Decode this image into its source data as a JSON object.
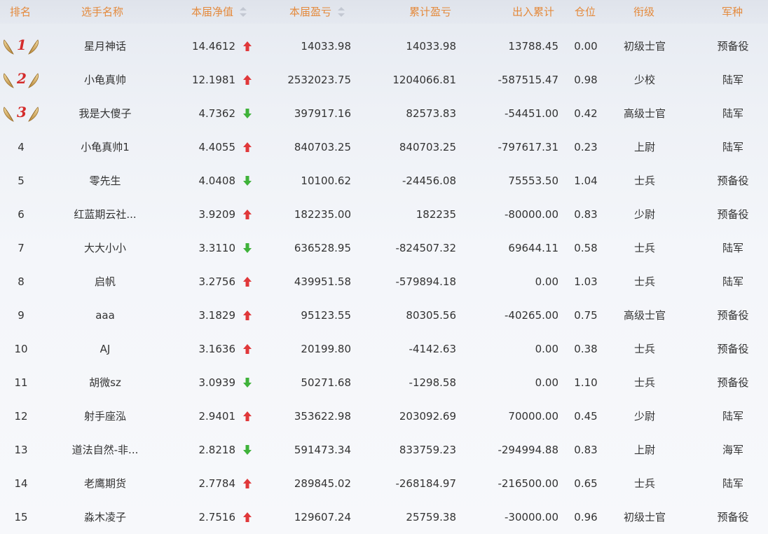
{
  "columns": {
    "rank": "排名",
    "player": "选手名称",
    "nav": "本届净值",
    "pnl": "本届盈亏",
    "cum_pnl": "累计盈亏",
    "flow": "出入累计",
    "position": "仓位",
    "title": "衔级",
    "service": "军种"
  },
  "colors": {
    "header_text": "#e48a3c",
    "up": "#e0383a",
    "down": "#3fb23a",
    "rank_badge": "#d42b2b"
  },
  "rows": [
    {
      "rank": "1",
      "top": true,
      "name": "星月神话",
      "nav": "14.4612",
      "trend": "up",
      "pnl": "14033.98",
      "cum": "14033.98",
      "flow": "13788.45",
      "pos": "0.00",
      "title": "初级士官",
      "service": "预备役"
    },
    {
      "rank": "2",
      "top": true,
      "name": "小龟真帅",
      "nav": "12.1981",
      "trend": "up",
      "pnl": "2532023.75",
      "cum": "1204066.81",
      "flow": "-587515.47",
      "pos": "0.98",
      "title": "少校",
      "service": "陆军"
    },
    {
      "rank": "3",
      "top": true,
      "name": "我是大傻子",
      "nav": "4.7362",
      "trend": "down",
      "pnl": "397917.16",
      "cum": "82573.83",
      "flow": "-54451.00",
      "pos": "0.42",
      "title": "高级士官",
      "service": "陆军"
    },
    {
      "rank": "4",
      "top": false,
      "name": "小龟真帅1",
      "nav": "4.4055",
      "trend": "up",
      "pnl": "840703.25",
      "cum": "840703.25",
      "flow": "-797617.31",
      "pos": "0.23",
      "title": "上尉",
      "service": "陆军"
    },
    {
      "rank": "5",
      "top": false,
      "name": "零先生",
      "nav": "4.0408",
      "trend": "down",
      "pnl": "10100.62",
      "cum": "-24456.08",
      "flow": "75553.50",
      "pos": "1.04",
      "title": "士兵",
      "service": "预备役"
    },
    {
      "rank": "6",
      "top": false,
      "name": "红蓝期云社...",
      "nav": "3.9209",
      "trend": "up",
      "pnl": "182235.00",
      "cum": "182235",
      "flow": "-80000.00",
      "pos": "0.83",
      "title": "少尉",
      "service": "预备役"
    },
    {
      "rank": "7",
      "top": false,
      "name": "大大小小",
      "nav": "3.3110",
      "trend": "down",
      "pnl": "636528.95",
      "cum": "-824507.32",
      "flow": "69644.11",
      "pos": "0.58",
      "title": "士兵",
      "service": "陆军"
    },
    {
      "rank": "8",
      "top": false,
      "name": "启帆",
      "nav": "3.2756",
      "trend": "up",
      "pnl": "439951.58",
      "cum": "-579894.18",
      "flow": "0.00",
      "pos": "1.03",
      "title": "士兵",
      "service": "陆军"
    },
    {
      "rank": "9",
      "top": false,
      "name": "aaa",
      "nav": "3.1829",
      "trend": "up",
      "pnl": "95123.55",
      "cum": "80305.56",
      "flow": "-40265.00",
      "pos": "0.75",
      "title": "高级士官",
      "service": "预备役"
    },
    {
      "rank": "10",
      "top": false,
      "name": "AJ",
      "nav": "3.1636",
      "trend": "up",
      "pnl": "20199.80",
      "cum": "-4142.63",
      "flow": "0.00",
      "pos": "0.38",
      "title": "士兵",
      "service": "预备役"
    },
    {
      "rank": "11",
      "top": false,
      "name": "胡微sz",
      "nav": "3.0939",
      "trend": "down",
      "pnl": "50271.68",
      "cum": "-1298.58",
      "flow": "0.00",
      "pos": "1.10",
      "title": "士兵",
      "service": "预备役"
    },
    {
      "rank": "12",
      "top": false,
      "name": "射手座泓",
      "nav": "2.9401",
      "trend": "up",
      "pnl": "353622.98",
      "cum": "203092.69",
      "flow": "70000.00",
      "pos": "0.45",
      "title": "少尉",
      "service": "陆军"
    },
    {
      "rank": "13",
      "top": false,
      "name": "道法自然-非...",
      "nav": "2.8218",
      "trend": "down",
      "pnl": "591473.34",
      "cum": "833759.23",
      "flow": "-294994.88",
      "pos": "0.83",
      "title": "上尉",
      "service": "海军"
    },
    {
      "rank": "14",
      "top": false,
      "name": "老鹰期货",
      "nav": "2.7784",
      "trend": "up",
      "pnl": "289845.02",
      "cum": "-268184.97",
      "flow": "-216500.00",
      "pos": "0.65",
      "title": "士兵",
      "service": "陆军"
    },
    {
      "rank": "15",
      "top": false,
      "name": "淼木凌子",
      "nav": "2.7516",
      "trend": "up",
      "pnl": "129607.24",
      "cum": "25759.38",
      "flow": "-30000.00",
      "pos": "0.96",
      "title": "初级士官",
      "service": "预备役"
    }
  ]
}
